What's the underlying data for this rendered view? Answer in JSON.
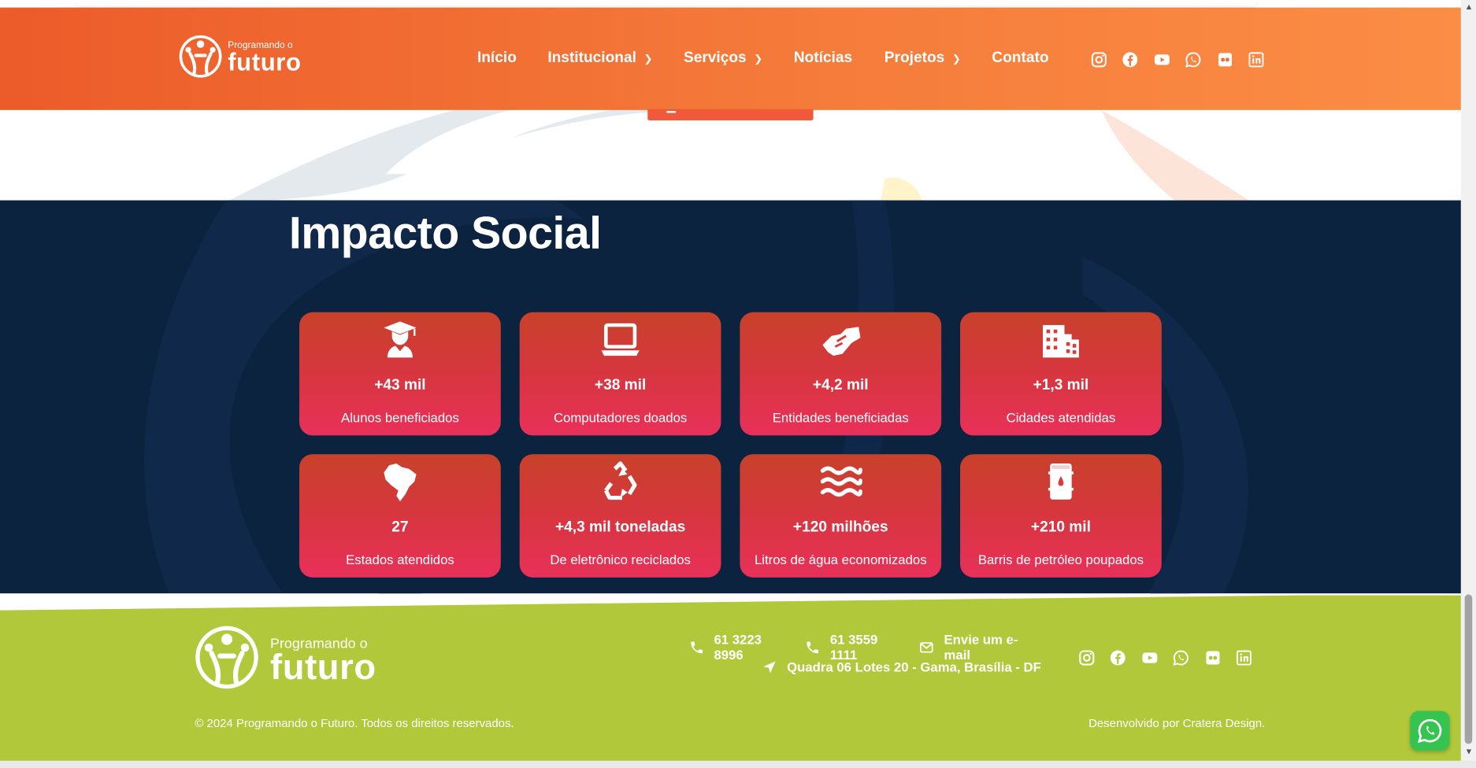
{
  "header": {
    "logo_small": "Programando o",
    "logo_big": "futuro",
    "nav": [
      {
        "label": "Início",
        "has_dropdown": false
      },
      {
        "label": "Institucional",
        "has_dropdown": true
      },
      {
        "label": "Serviços",
        "has_dropdown": true
      },
      {
        "label": "Notícias",
        "has_dropdown": false
      },
      {
        "label": "Projetos",
        "has_dropdown": true
      },
      {
        "label": "Contato",
        "has_dropdown": false
      }
    ],
    "social_icons": [
      "instagram-icon",
      "facebook-icon",
      "youtube-icon",
      "whatsapp-icon",
      "flickr-icon",
      "linkedin-icon"
    ]
  },
  "impact": {
    "title": "Impacto Social",
    "cards": [
      {
        "icon": "graduate-icon",
        "value": "+43 mil",
        "label": "Alunos beneficiados"
      },
      {
        "icon": "laptop-icon",
        "value": "+38 mil",
        "label": "Computadores doados"
      },
      {
        "icon": "handshake-icon",
        "value": "+4,2 mil",
        "label": "Entidades beneficiadas"
      },
      {
        "icon": "city-icon",
        "value": "+1,3 mil",
        "label": "Cidades atendidas"
      },
      {
        "icon": "brazil-map-icon",
        "value": "27",
        "label": "Estados atendidos"
      },
      {
        "icon": "recycle-icon",
        "value": "+4,3 mil toneladas",
        "label": "De eletrônico reciclados"
      },
      {
        "icon": "water-icon",
        "value": "+120 milhões",
        "label": "Litros de água economizados"
      },
      {
        "icon": "oil-barrel-icon",
        "value": "+210 mil",
        "label": "Barris de petróleo poupados"
      }
    ]
  },
  "footer": {
    "logo_small": "Programando o",
    "logo_big": "futuro",
    "phone1": "61 3223 8996",
    "phone2": "61 3559 1111",
    "email_label": "Envie um e-mail",
    "address": "Quadra 06 Lotes 20 - Gama, Brasília - DF",
    "copyright": "© 2024 Programando o Futuro. Todos os direitos reservados.",
    "credits": "Desenvolvido por Cratera Design."
  },
  "colors": {
    "header_start": "#ec5b2a",
    "header_end": "#fb8d45",
    "impact_bg": "#0c2340",
    "card_top": "#c8412a",
    "card_bottom": "#e9305a",
    "footer_bg": "#b0c83a",
    "whatsapp": "#36c451"
  }
}
